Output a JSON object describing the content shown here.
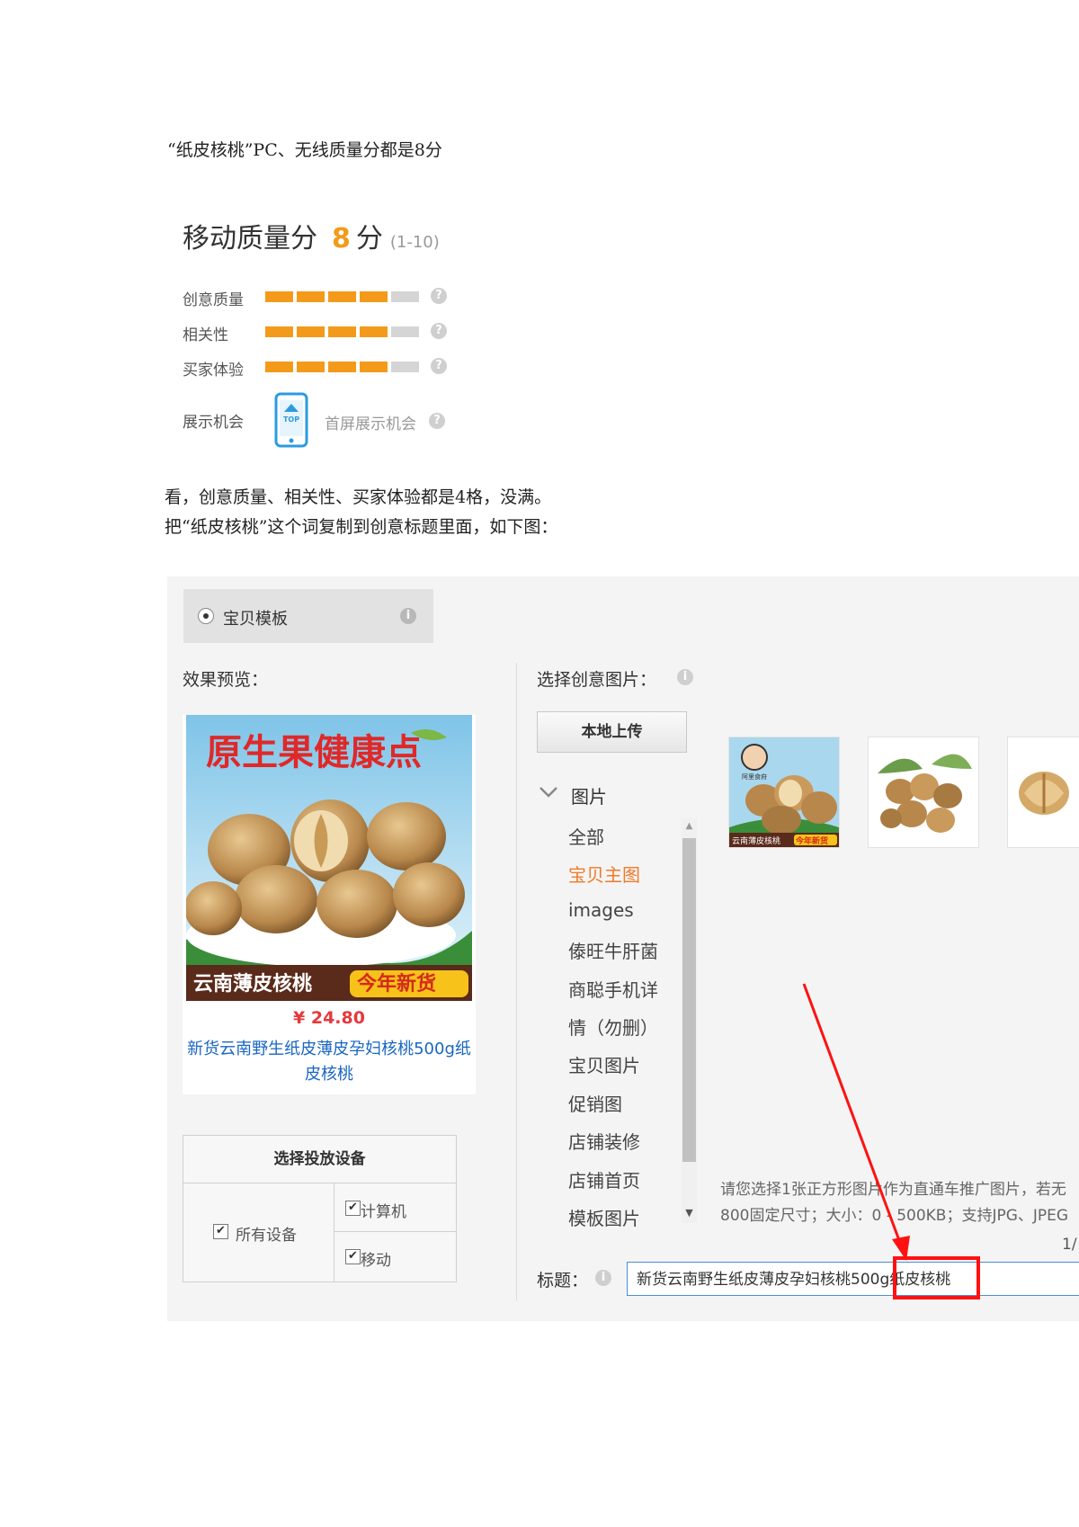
{
  "doc": {
    "intro": "“纸皮核桃”PC、无线质量分都是8分",
    "line2": "看，创意质量、相关性、买家体验都是4格，没满。",
    "line3": "把“纸皮核桃”这个词复制到创意标题里面，如下图："
  },
  "quality": {
    "title": "移动质量分",
    "score": "8",
    "unit": "分",
    "range": "(1-10)",
    "rows": [
      {
        "label": "创意质量",
        "filled": 4,
        "total": 5
      },
      {
        "label": "相关性",
        "filled": 4,
        "total": 5
      },
      {
        "label": "买家体验",
        "filled": 4,
        "total": 5
      }
    ],
    "display_label": "展示机会",
    "display_icon_text": "TOP",
    "display_value": "首屏展示机会"
  },
  "editor": {
    "template_label": "宝贝模板",
    "preview_label": "效果预览：",
    "preview_banner_top": "原生果健康点",
    "preview_banner_bottom_left": "云南薄皮核桃",
    "preview_banner_bottom_right": "今年新货",
    "price": "¥ 24.80",
    "product_title": "新货云南野生纸皮薄皮孕妇核桃500g纸皮核桃",
    "device_header": "选择投放设备",
    "device_all": "所有设备",
    "device_pc": "计算机",
    "device_mobile": "移动",
    "select_image_label": "选择创意图片：",
    "upload_button": "本地上传",
    "folder_root": "图片",
    "folders": [
      "全部",
      "宝贝主图",
      "images",
      "傣旺牛肝菌",
      "商聪手机详",
      "情（勿删）",
      "宝贝图片",
      "促销图",
      "店铺装修",
      "店铺首页",
      "模板图片"
    ],
    "active_folder": "宝贝主图",
    "thumb1_top": "阿里食府",
    "thumb1_bottom_left": "云南薄皮核桃",
    "thumb1_bottom_right": "今年新货",
    "note_line1": "请您选择1张正方形图片作为直通车推广图片，若无",
    "note_line2": "800固定尺寸；大小：0 - 500KB；支持JPG、JPEG",
    "page_indicator": "1/",
    "title_label": "标题：",
    "title_value": "新货云南野生纸皮薄皮孕妇核桃500g纸皮核桃"
  },
  "colors": {
    "accent": "#f39a1b",
    "highlight": "#ff1111",
    "link": "#1a66c2",
    "price": "#e4393c"
  }
}
